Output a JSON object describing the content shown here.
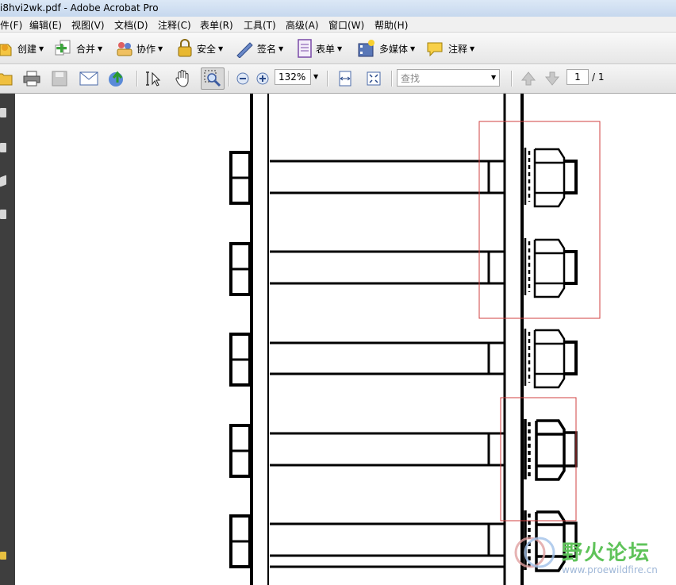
{
  "window": {
    "title": "i8hvi2wk.pdf - Adobe Acrobat Pro"
  },
  "menu": [
    "件(F)",
    "编辑(E)",
    "视图(V)",
    "文档(D)",
    "注释(C)",
    "表单(R)",
    "工具(T)",
    "高级(A)",
    "窗口(W)",
    "帮助(H)"
  ],
  "toolbar": {
    "create": "创建",
    "combine": "合并",
    "collaborate": "协作",
    "secure": "安全",
    "sign": "签名",
    "forms": "表单",
    "multimedia": "多媒体",
    "comment": "注释"
  },
  "nav": {
    "zoom": "132%",
    "find_placeholder": "查找",
    "page_current": "1",
    "page_total": "/ 1"
  },
  "watermark": {
    "name": "野火论坛",
    "url": "www.proewildfire.cn"
  },
  "icons": [
    "open-icon",
    "print-icon",
    "save-icon",
    "email-icon",
    "upload-icon",
    "select-text-icon",
    "hand-icon",
    "zoom-marquee-icon",
    "zoom-out-icon",
    "zoom-in-icon",
    "fit-width-icon",
    "fit-page-icon",
    "prev-page-icon",
    "next-page-icon"
  ]
}
